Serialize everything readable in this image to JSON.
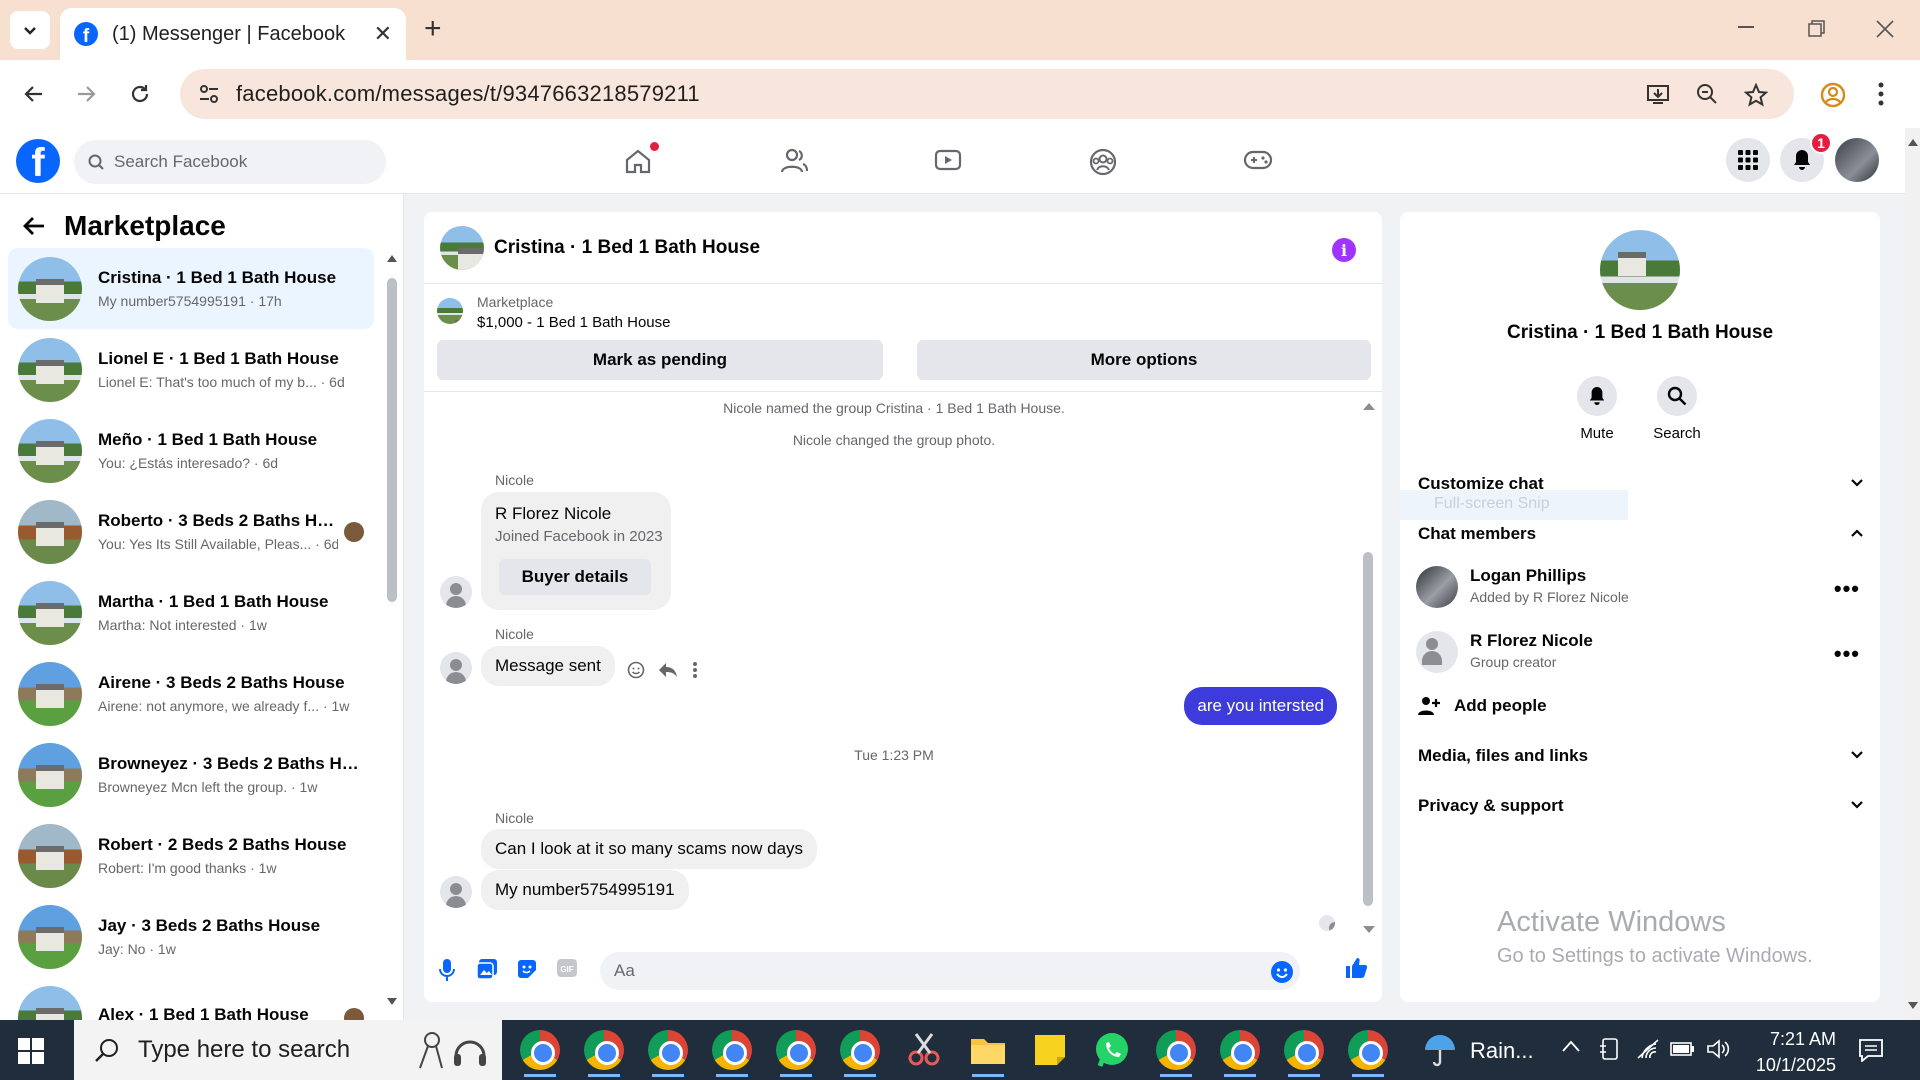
{
  "browser": {
    "tab_title": "(1) Messenger | Facebook",
    "url": "facebook.com/messages/t/9347663218579211"
  },
  "facebook": {
    "search_placeholder": "Search Facebook",
    "notification_count": "1",
    "brand_color": "#0866ff"
  },
  "left": {
    "title": "Marketplace",
    "chats": [
      {
        "name": "Cristina · 1 Bed 1 Bath House",
        "sub": "My number5754995191 · 17h",
        "active": true
      },
      {
        "name": "Lionel E · 1 Bed 1 Bath House",
        "sub": "Lionel E: That's too much of my b... · 6d"
      },
      {
        "name": "Meño · 1 Bed 1 Bath House",
        "sub": "You: ¿Estás interesado? · 6d"
      },
      {
        "name": "Roberto · 3 Beds 2 Baths Hou...",
        "sub": "You: Yes Its Still Available, Pleas... · 6d"
      },
      {
        "name": "Martha · 1 Bed 1 Bath House",
        "sub": "Martha: Not interested · 1w"
      },
      {
        "name": "Airene · 3 Beds 2 Baths House",
        "sub": "Airene: not anymore, we already f... · 1w"
      },
      {
        "name": "Browneyez · 3 Beds 2 Baths Ho...",
        "sub": "Browneyez Mcn left the group. · 1w"
      },
      {
        "name": "Robert · 2 Beds 2 Baths House",
        "sub": "Robert: I'm good thanks · 1w"
      },
      {
        "name": "Jay · 3 Beds 2 Baths House",
        "sub": "Jay: No · 1w"
      },
      {
        "name": "Alex · 1 Bed 1 Bath House",
        "sub": ""
      }
    ]
  },
  "conversation": {
    "title": "Cristina · 1 Bed 1 Bath House",
    "listing_label": "Marketplace",
    "listing_title": "$1,000 - 1 Bed 1 Bath House",
    "btn_pending": "Mark as pending",
    "btn_more": "More options",
    "sys1": "Nicole named the group Cristina · 1 Bed 1 Bath House.",
    "sys2": "Nicole changed the group photo.",
    "sender": "Nicole",
    "card_name": "R Florez Nicole",
    "card_sub": "Joined Facebook in 2023",
    "card_button": "Buyer details",
    "msg_sent": "Message sent",
    "my_msg": "are you intersted",
    "timestamp": "Tue 1:23 PM",
    "msg_look": "Can I look at it so many scams now days",
    "msg_number": "My number5754995191",
    "composer_placeholder": "Aa",
    "accent": "#3e3bdc"
  },
  "details": {
    "name": "Cristina · 1 Bed 1 Bath House",
    "mute": "Mute",
    "search": "Search",
    "customize": "Customize chat",
    "ghost": "Full-screen Snip",
    "members_title": "Chat members",
    "members": [
      {
        "name": "Logan Phillips",
        "sub": "Added by R Florez Nicole"
      },
      {
        "name": "R Florez Nicole",
        "sub": "Group creator"
      }
    ],
    "add_people": "Add people",
    "media": "Media, files and links",
    "privacy": "Privacy & support"
  },
  "watermark": {
    "line1": "Activate Windows",
    "line2": "Go to Settings to activate Windows."
  },
  "taskbar": {
    "search_placeholder": "Type here to search",
    "weather": "Rain...",
    "time": "7:21 AM",
    "date": "10/1/2025"
  }
}
